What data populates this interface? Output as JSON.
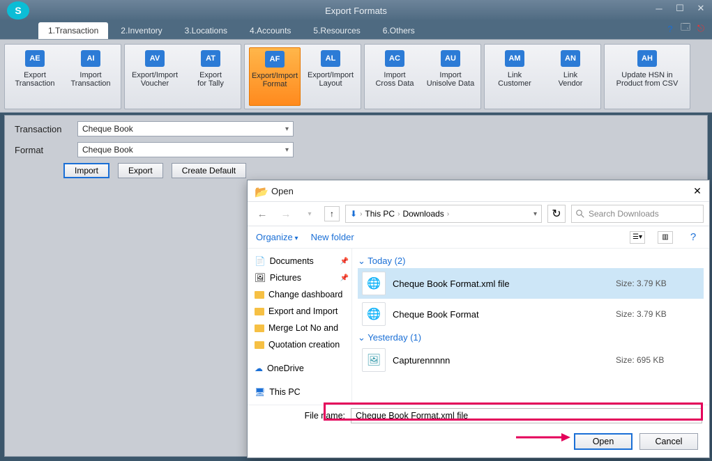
{
  "window": {
    "title": "Export Formats"
  },
  "tabs": [
    "1.Transaction",
    "2.Inventory",
    "3.Locations",
    "4.Accounts",
    "5.Resources",
    "6.Others"
  ],
  "ribbon": {
    "groups": [
      {
        "items": [
          {
            "icon": "AE",
            "l1": "Export",
            "l2": "Transaction"
          },
          {
            "icon": "AI",
            "l1": "Import",
            "l2": "Transaction"
          }
        ]
      },
      {
        "items": [
          {
            "icon": "AV",
            "l1": "Export/Import",
            "l2": "Voucher"
          },
          {
            "icon": "AT",
            "l1": "Export",
            "l2": "for Tally"
          }
        ]
      },
      {
        "items": [
          {
            "icon": "AF",
            "l1": "Export/Import",
            "l2": "Format",
            "active": true
          },
          {
            "icon": "AL",
            "l1": "Export/Import",
            "l2": "Layout"
          }
        ]
      },
      {
        "items": [
          {
            "icon": "AC",
            "l1": "Import",
            "l2": "Cross Data"
          },
          {
            "icon": "AU",
            "l1": "Import",
            "l2": "Unisolve Data"
          }
        ]
      },
      {
        "items": [
          {
            "icon": "AM",
            "l1": "Link",
            "l2": "Customer"
          },
          {
            "icon": "AN",
            "l1": "Link",
            "l2": "Vendor"
          }
        ]
      },
      {
        "items": [
          {
            "icon": "AH",
            "l1": "Update HSN in",
            "l2": "Product from CSV",
            "wide": true
          }
        ]
      }
    ]
  },
  "form": {
    "transaction_label": "Transaction",
    "transaction_value": "Cheque Book",
    "format_label": "Format",
    "format_value": "Cheque Book",
    "import_btn": "Import",
    "export_btn": "Export",
    "create_default_btn": "Create Default"
  },
  "dialog": {
    "title": "Open",
    "crumb1": "This PC",
    "crumb2": "Downloads",
    "search_placeholder": "Search Downloads",
    "organize": "Organize",
    "newfolder": "New folder",
    "nav": {
      "documents": "Documents",
      "pictures": "Pictures",
      "n1": "Change dashboard",
      "n2": "Export and Import",
      "n3": "Merge Lot No and",
      "n4": "Quotation creation",
      "onedrive": "OneDrive",
      "thispc": "This PC"
    },
    "groups": {
      "today": "Today (2)",
      "yesterday": "Yesterday (1)"
    },
    "files": [
      {
        "name": "Cheque Book Format.xml file",
        "size": "Size: 3.79 KB",
        "sel": true,
        "icon": "🌐"
      },
      {
        "name": "Cheque Book Format",
        "size": "Size: 3.79 KB",
        "icon": "🌐"
      },
      {
        "name": "Capturennnnn",
        "size": "Size: 695 KB",
        "icon": "🖼"
      }
    ],
    "fn_label": "File name:",
    "fn_value": "Cheque Book Format.xml file",
    "open": "Open",
    "cancel": "Cancel"
  }
}
